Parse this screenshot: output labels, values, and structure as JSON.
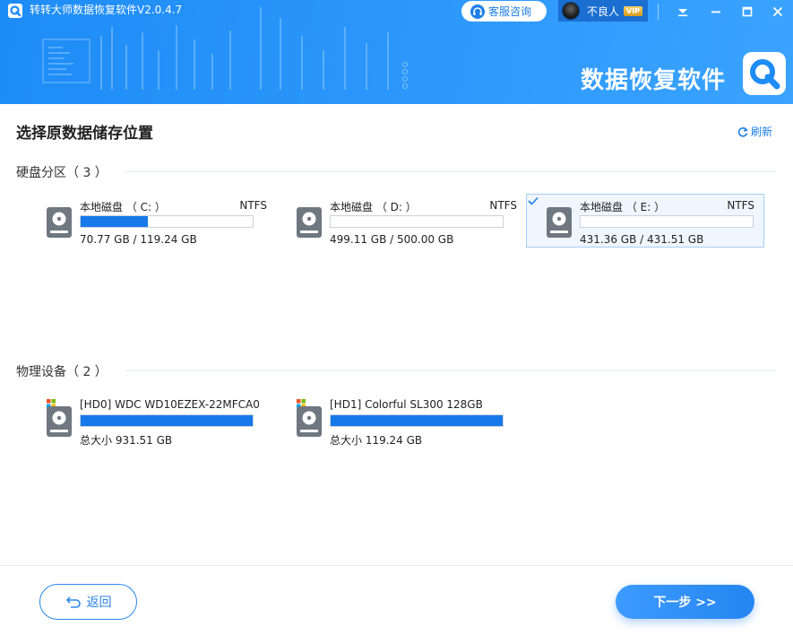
{
  "header": {
    "app_title": "转转大师数据恢复软件V2.0.4.7",
    "service_label": "客服咨询",
    "user_name": "不良人",
    "vip_label": "VIP",
    "brand_text": "数据恢复软件"
  },
  "page": {
    "title": "选择原数据储存位置",
    "refresh_label": "刷新"
  },
  "partitions": {
    "title": "硬盘分区（ 3 ）",
    "items": [
      {
        "name": "本地磁盘 （ C: ）",
        "fs": "NTFS",
        "size": "70.77 GB / 119.24 GB",
        "used_fraction": 0.39,
        "selected": false
      },
      {
        "name": "本地磁盘 （ D: ）",
        "fs": "NTFS",
        "size": "499.11 GB / 500.00 GB",
        "used_fraction": 0.0,
        "selected": false
      },
      {
        "name": "本地磁盘 （ E: ）",
        "fs": "NTFS",
        "size": "431.36 GB / 431.51 GB",
        "used_fraction": 0.0,
        "selected": true
      }
    ]
  },
  "devices": {
    "title": "物理设备（ 2 ）",
    "items": [
      {
        "name": "[HD0] WDC WD10EZEX-22MFCA0",
        "size": "总大小 931.51 GB",
        "used_fraction": 1.0
      },
      {
        "name": "[HD1] Colorful SL300 128GB",
        "size": "总大小 119.24 GB",
        "used_fraction": 1.0
      }
    ]
  },
  "footer": {
    "back_label": "返回",
    "next_label": "下一步 >>"
  },
  "colors": {
    "accent": "#1779e9",
    "header_bg": "#2a96fb",
    "selected_bg": "#f0f6fd"
  },
  "icons": {
    "app_logo": "q-logo-icon",
    "service": "headset-icon",
    "minimize_tray": "down-arrow-icon",
    "minimize": "minimize-icon",
    "maximize": "maximize-icon",
    "close": "close-icon",
    "refresh": "refresh-icon",
    "drive": "hdd-icon",
    "device_flag": "windows-icon",
    "back": "back-arrow-icon"
  }
}
